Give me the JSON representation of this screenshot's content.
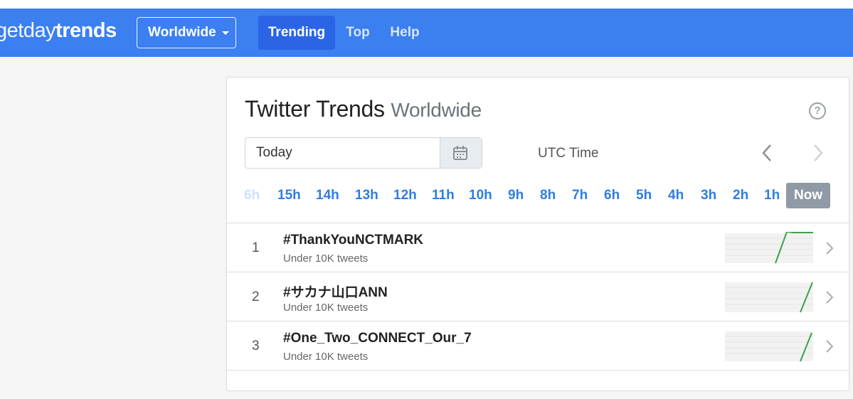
{
  "brand": {
    "part1": "getday",
    "part2": "trends"
  },
  "nav": {
    "location": "Worldwide",
    "links": [
      {
        "label": "Trending",
        "active": true
      },
      {
        "label": "Top",
        "active": false
      },
      {
        "label": "Help",
        "active": false
      }
    ]
  },
  "card": {
    "title": "Twitter Trends",
    "subtitle": "Worldwide",
    "date_value": "Today",
    "timezone": "UTC Time",
    "hours": [
      "6h",
      "15h",
      "14h",
      "13h",
      "12h",
      "11h",
      "10h",
      "9h",
      "8h",
      "7h",
      "6h",
      "5h",
      "4h",
      "3h",
      "2h",
      "1h",
      "Now"
    ],
    "selected_hour": "Now"
  },
  "trends": [
    {
      "rank": "1",
      "name": "#ThankYouNCTMARK",
      "count": "Under 10K tweets",
      "spark": "plateau"
    },
    {
      "rank": "2",
      "name": "#サカナ山口ANN",
      "count": "Under 10K tweets",
      "spark": "rise"
    },
    {
      "rank": "3",
      "name": "#One_Two_CONNECT_Our_7",
      "count": "Under 10K tweets",
      "spark": "rise"
    }
  ],
  "colors": {
    "navbar": "#3b7ff0",
    "accent": "#2f7de1",
    "spark_line": "#3aa14a",
    "now_badge": "#8f9aa5"
  }
}
